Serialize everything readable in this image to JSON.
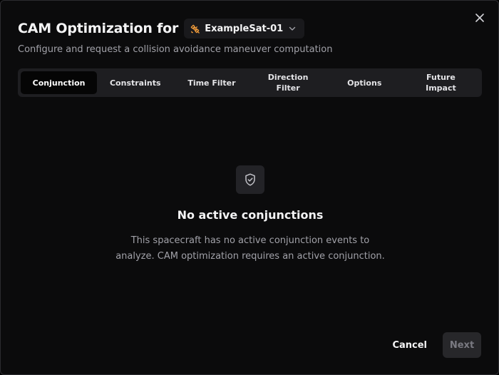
{
  "dialog": {
    "title": "CAM Optimization for",
    "subtitle": "Configure and request a collision avoidance maneuver computation",
    "satellite_select": {
      "value": "ExampleSat-01",
      "icon": "satellite-icon",
      "icon_color": "#f59e3b"
    },
    "close_icon": "close-icon"
  },
  "tabs": [
    {
      "label": "Conjunction",
      "active": true
    },
    {
      "label": "Constraints",
      "active": false
    },
    {
      "label": "Time Filter",
      "active": false
    },
    {
      "label": "Direction Filter",
      "active": false
    },
    {
      "label": "Options",
      "active": false
    },
    {
      "label": "Future Impact",
      "active": false
    }
  ],
  "empty_state": {
    "icon": "shield-check-icon",
    "title": "No active conjunctions",
    "description": "This spacecraft has no active conjunction events to analyze. CAM optimization requires an active conjunction."
  },
  "footer": {
    "cancel_label": "Cancel",
    "next_label": "Next"
  }
}
